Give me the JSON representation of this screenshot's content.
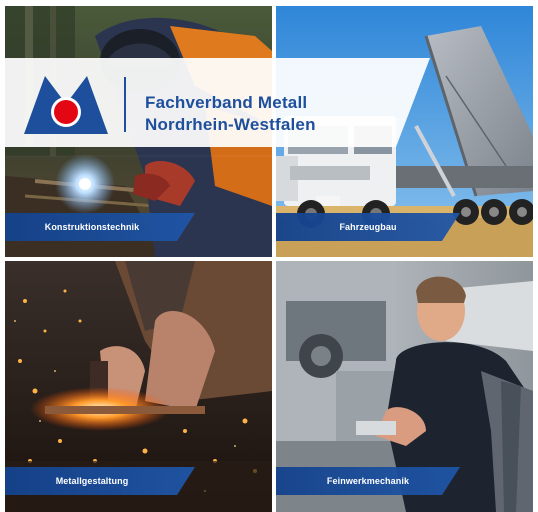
{
  "brand": {
    "line1": "Fachverband Metall",
    "line2": "Nordrhein-Westfalen",
    "logo_icon": "fachverband-m-logo-icon",
    "colors": {
      "primary": "#1e4f9c",
      "accent": "#e30613"
    }
  },
  "tiles": [
    {
      "label": "Konstruktionstechnik"
    },
    {
      "label": "Fahrzeugbau"
    },
    {
      "label": "Metallgestaltung"
    },
    {
      "label": "Feinwerkmechanik"
    }
  ]
}
